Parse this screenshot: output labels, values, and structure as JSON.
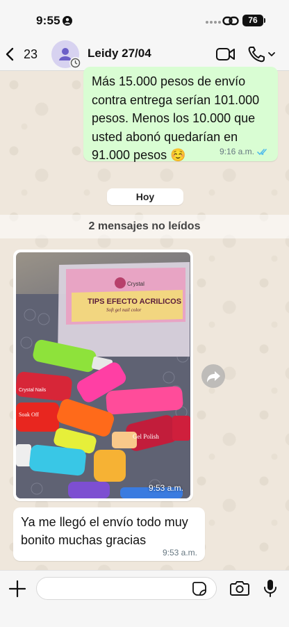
{
  "status_bar": {
    "time": "9:55",
    "battery": "76"
  },
  "header": {
    "back_count": "23",
    "contact_name": "Leidy 27/04"
  },
  "messages": {
    "outgoing": {
      "text": "Más 15.000 pesos de envío contra entrega serían 101.000 pesos. Menos los 10.000 que usted abonó quedarían en 91.000 pesos ☺️",
      "time": "9:16 a.m."
    },
    "day_label": "Hoy",
    "unread_label": "2 mensajes no leídos",
    "image": {
      "time": "9:53 a.m.",
      "box_label": "TIPS EFECTO ACRILICOS",
      "box_sublabel": "Soft gel nail color",
      "polish_labels": [
        "Crystal Nails",
        "Soak Off",
        "Gel Polish"
      ]
    },
    "incoming": {
      "text": "Ya me llegó el envío todo muy bonito muchas gracias",
      "time": "9:53 a.m."
    }
  },
  "input": {
    "value": "",
    "placeholder": ""
  },
  "colors": {
    "outgoing_bubble": "#d9fdd3",
    "incoming_bubble": "#ffffff",
    "read_ticks": "#53bdeb",
    "wallpaper": "#efe7dc"
  },
  "icons": [
    "chevron-left-icon",
    "person-icon",
    "link-icon",
    "video-icon",
    "phone-icon",
    "forward-icon",
    "plus-icon",
    "sticker-icon",
    "camera-icon",
    "mic-icon"
  ]
}
